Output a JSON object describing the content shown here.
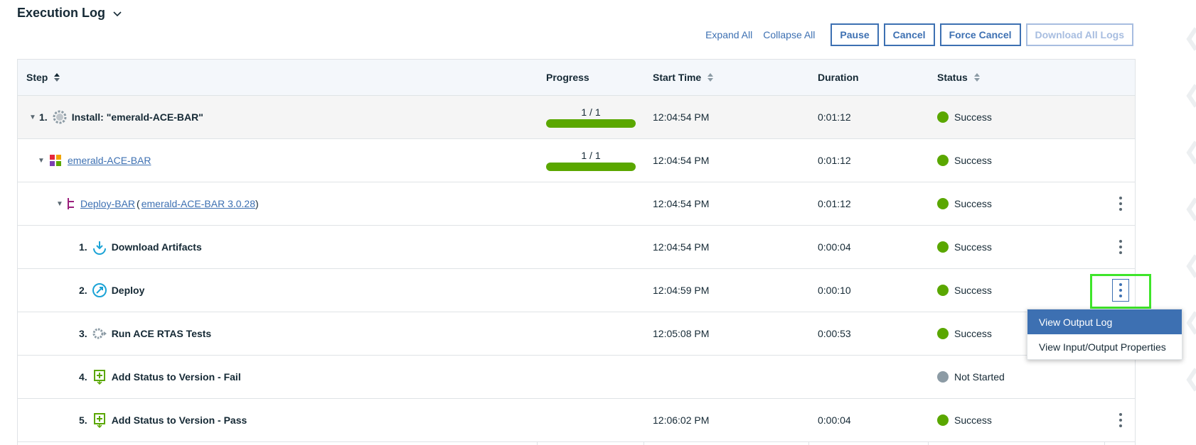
{
  "header": {
    "title": "Execution Log"
  },
  "actions": {
    "expand_all": "Expand All",
    "collapse_all": "Collapse All",
    "pause": "Pause",
    "cancel": "Cancel",
    "force_cancel": "Force Cancel",
    "download_all_logs": "Download All Logs"
  },
  "columns": {
    "step": "Step",
    "progress": "Progress",
    "start_time": "Start Time",
    "duration": "Duration",
    "status": "Status"
  },
  "rows": [
    {
      "number": "1.",
      "name": "Install: \"emerald-ACE-BAR\"",
      "progress": "1 / 1",
      "progress_fraction": 1.0,
      "start": "12:04:54 PM",
      "duration": "0:01:12",
      "status": "Success",
      "icon": "gear-icon"
    },
    {
      "name": "emerald-ACE-BAR",
      "progress": "1 / 1",
      "progress_fraction": 1.0,
      "start": "12:04:54 PM",
      "duration": "0:01:12",
      "status": "Success",
      "icon": "component-icon"
    },
    {
      "name": "Deploy-BAR",
      "version": "emerald-ACE-BAR 3.0.28",
      "open_paren": "(",
      "close_paren": ")",
      "start": "12:04:54 PM",
      "duration": "0:01:12",
      "status": "Success",
      "icon": "process-icon"
    },
    {
      "number": "1.",
      "name": "Download Artifacts",
      "start": "12:04:54 PM",
      "duration": "0:00:04",
      "status": "Success",
      "icon": "download-icon"
    },
    {
      "number": "2.",
      "name": "Deploy",
      "start": "12:04:59 PM",
      "duration": "0:00:10",
      "status": "Success",
      "icon": "deploy-icon"
    },
    {
      "number": "3.",
      "name": "Run ACE RTAS Tests",
      "start": "12:05:08 PM",
      "duration": "0:00:53",
      "status": "Success",
      "icon": "gear-run-icon"
    },
    {
      "number": "4.",
      "name": "Add Status to Version - Fail",
      "start": "",
      "duration": "",
      "status": "Not Started",
      "icon": "add-status-icon"
    },
    {
      "number": "5.",
      "name": "Add Status to Version - Pass",
      "start": "12:06:02 PM",
      "duration": "0:00:04",
      "status": "Success",
      "icon": "add-status-icon"
    }
  ],
  "dropdown": {
    "items": [
      "View Output Log",
      "View Input/Output Properties"
    ]
  },
  "colors": {
    "accent": "#3d70b2",
    "success": "#5aa700",
    "not_started": "#8c9ba5",
    "highlight": "#3ee52a"
  }
}
